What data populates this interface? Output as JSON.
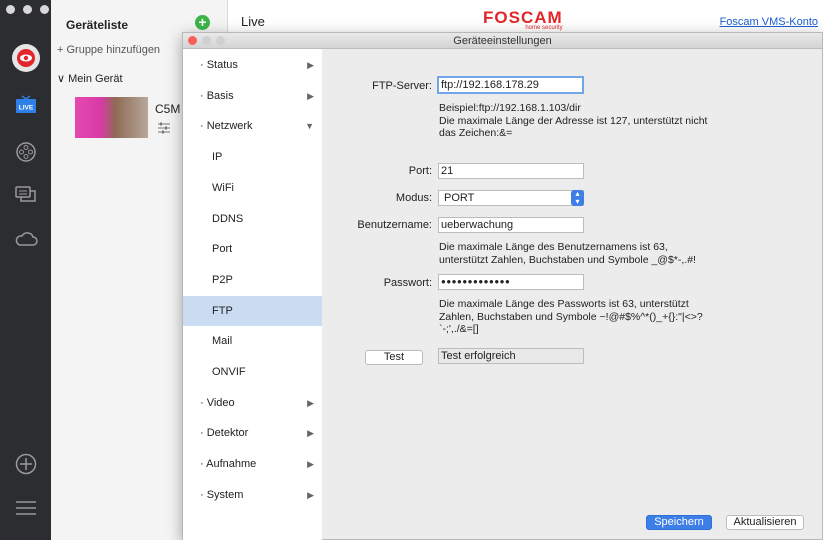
{
  "sidebar": {
    "icons": [
      "logo-icon",
      "live-icon",
      "film-reel-icon",
      "chat-icon",
      "cloud-icon",
      "add-circle-icon",
      "menu-icon"
    ],
    "live_badge": "LIVE"
  },
  "device_list": {
    "title": "Geräteliste",
    "add_group": "+ Gruppe hinzufügen",
    "group_label": "Mein Gerät",
    "camera_name": "C5M"
  },
  "topbar": {
    "live_label": "Live",
    "brand": "FOSCAM",
    "brand_tagline": "home security",
    "account_link": "Foscam VMS-Konto"
  },
  "dialog": {
    "title": "Geräteeinstellungen",
    "nav": [
      {
        "label": "· Status",
        "arrow": "▶",
        "sub": false
      },
      {
        "label": "· Basis",
        "arrow": "▶",
        "sub": false
      },
      {
        "label": "· Netzwerk",
        "arrow": "▼",
        "sub": false
      },
      {
        "label": "IP",
        "arrow": "",
        "sub": true
      },
      {
        "label": "WiFi",
        "arrow": "",
        "sub": true
      },
      {
        "label": "DDNS",
        "arrow": "",
        "sub": true
      },
      {
        "label": "Port",
        "arrow": "",
        "sub": true
      },
      {
        "label": "P2P",
        "arrow": "",
        "sub": true
      },
      {
        "label": "FTP",
        "arrow": "",
        "sub": true,
        "active": true
      },
      {
        "label": "Mail",
        "arrow": "",
        "sub": true
      },
      {
        "label": "ONVIF",
        "arrow": "",
        "sub": true
      },
      {
        "label": "· Video",
        "arrow": "▶",
        "sub": false
      },
      {
        "label": "· Detektor",
        "arrow": "▶",
        "sub": false
      },
      {
        "label": "· Aufnahme",
        "arrow": "▶",
        "sub": false
      },
      {
        "label": "· System",
        "arrow": "▶",
        "sub": false
      }
    ],
    "form": {
      "ftp_server_label": "FTP-Server:",
      "ftp_server_value": "ftp://192.168.178.29",
      "ftp_hint": "Beispiel:ftp://192.168.1.103/dir\nDie maximale Länge der Adresse ist 127, unterstützt nicht\ndas Zeichen:&=",
      "port_label": "Port:",
      "port_value": "21",
      "mode_label": "Modus:",
      "mode_value": "PORT",
      "username_label": "Benutzername:",
      "username_value": "ueberwachung",
      "username_hint": "Die maximale Länge des Benutzernamens ist 63,\nunterstützt Zahlen, Buchstaben und Symbole _@$*-,.#!",
      "password_label": "Passwort:",
      "password_value": "●●●●●●●●●●●●●",
      "password_hint": "Die maximale Länge des Passworts ist 63, unterstützt\nZahlen, Buchstaben und Symbole ~!@#$%^*()_+{}:\"|<>?\n`-;',./&=[]",
      "test_button": "Test",
      "test_result": "Test erfolgreich"
    },
    "save_button": "Speichern",
    "refresh_button": "Aktualisieren"
  }
}
